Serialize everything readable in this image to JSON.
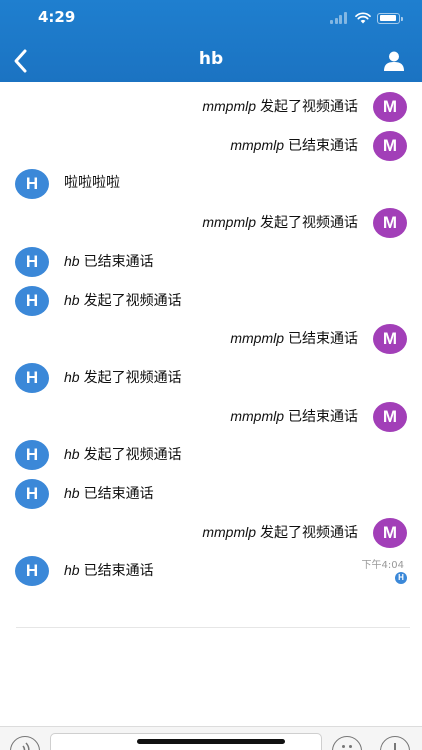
{
  "status_bar": {
    "time": "4:29",
    "battery_level": 0.9
  },
  "nav": {
    "title": "hb",
    "back_icon": "chevron-left-icon",
    "profile_icon": "person-icon"
  },
  "colors": {
    "header": "#1f7fcf",
    "avatar_self": "#3b88d8",
    "avatar_other": "#a23fb8"
  },
  "messages": [
    {
      "side": "right",
      "avatar": "M",
      "sender": "mmpmlp",
      "text": "发起了视频通话"
    },
    {
      "side": "right",
      "avatar": "M",
      "sender": "mmpmlp",
      "text": "已结束通话"
    },
    {
      "side": "left",
      "avatar": "H",
      "sender": "",
      "text": "啦啦啦啦"
    },
    {
      "side": "right",
      "avatar": "M",
      "sender": "mmpmlp",
      "text": "发起了视频通话"
    },
    {
      "side": "left",
      "avatar": "H",
      "sender": "hb",
      "text": "已结束通话"
    },
    {
      "side": "left",
      "avatar": "H",
      "sender": "hb",
      "text": "发起了视频通话"
    },
    {
      "side": "right",
      "avatar": "M",
      "sender": "mmpmlp",
      "text": "已结束通话"
    },
    {
      "side": "left",
      "avatar": "H",
      "sender": "hb",
      "text": "发起了视频通话"
    },
    {
      "side": "right",
      "avatar": "M",
      "sender": "mmpmlp",
      "text": "已结束通话"
    },
    {
      "side": "left",
      "avatar": "H",
      "sender": "hb",
      "text": "发起了视频通话"
    },
    {
      "side": "left",
      "avatar": "H",
      "sender": "hb",
      "text": "已结束通话"
    },
    {
      "side": "right",
      "avatar": "M",
      "sender": "mmpmlp",
      "text": "发起了视频通话"
    },
    {
      "side": "left",
      "avatar": "H",
      "sender": "hb",
      "text": "已结束通话",
      "time": "下午4:04",
      "read_badge": "H"
    }
  ],
  "input_bar": {
    "voice_icon": "voice-icon",
    "emoji_icon": "emoji-icon",
    "plus_icon": "plus-icon",
    "placeholder": ""
  }
}
